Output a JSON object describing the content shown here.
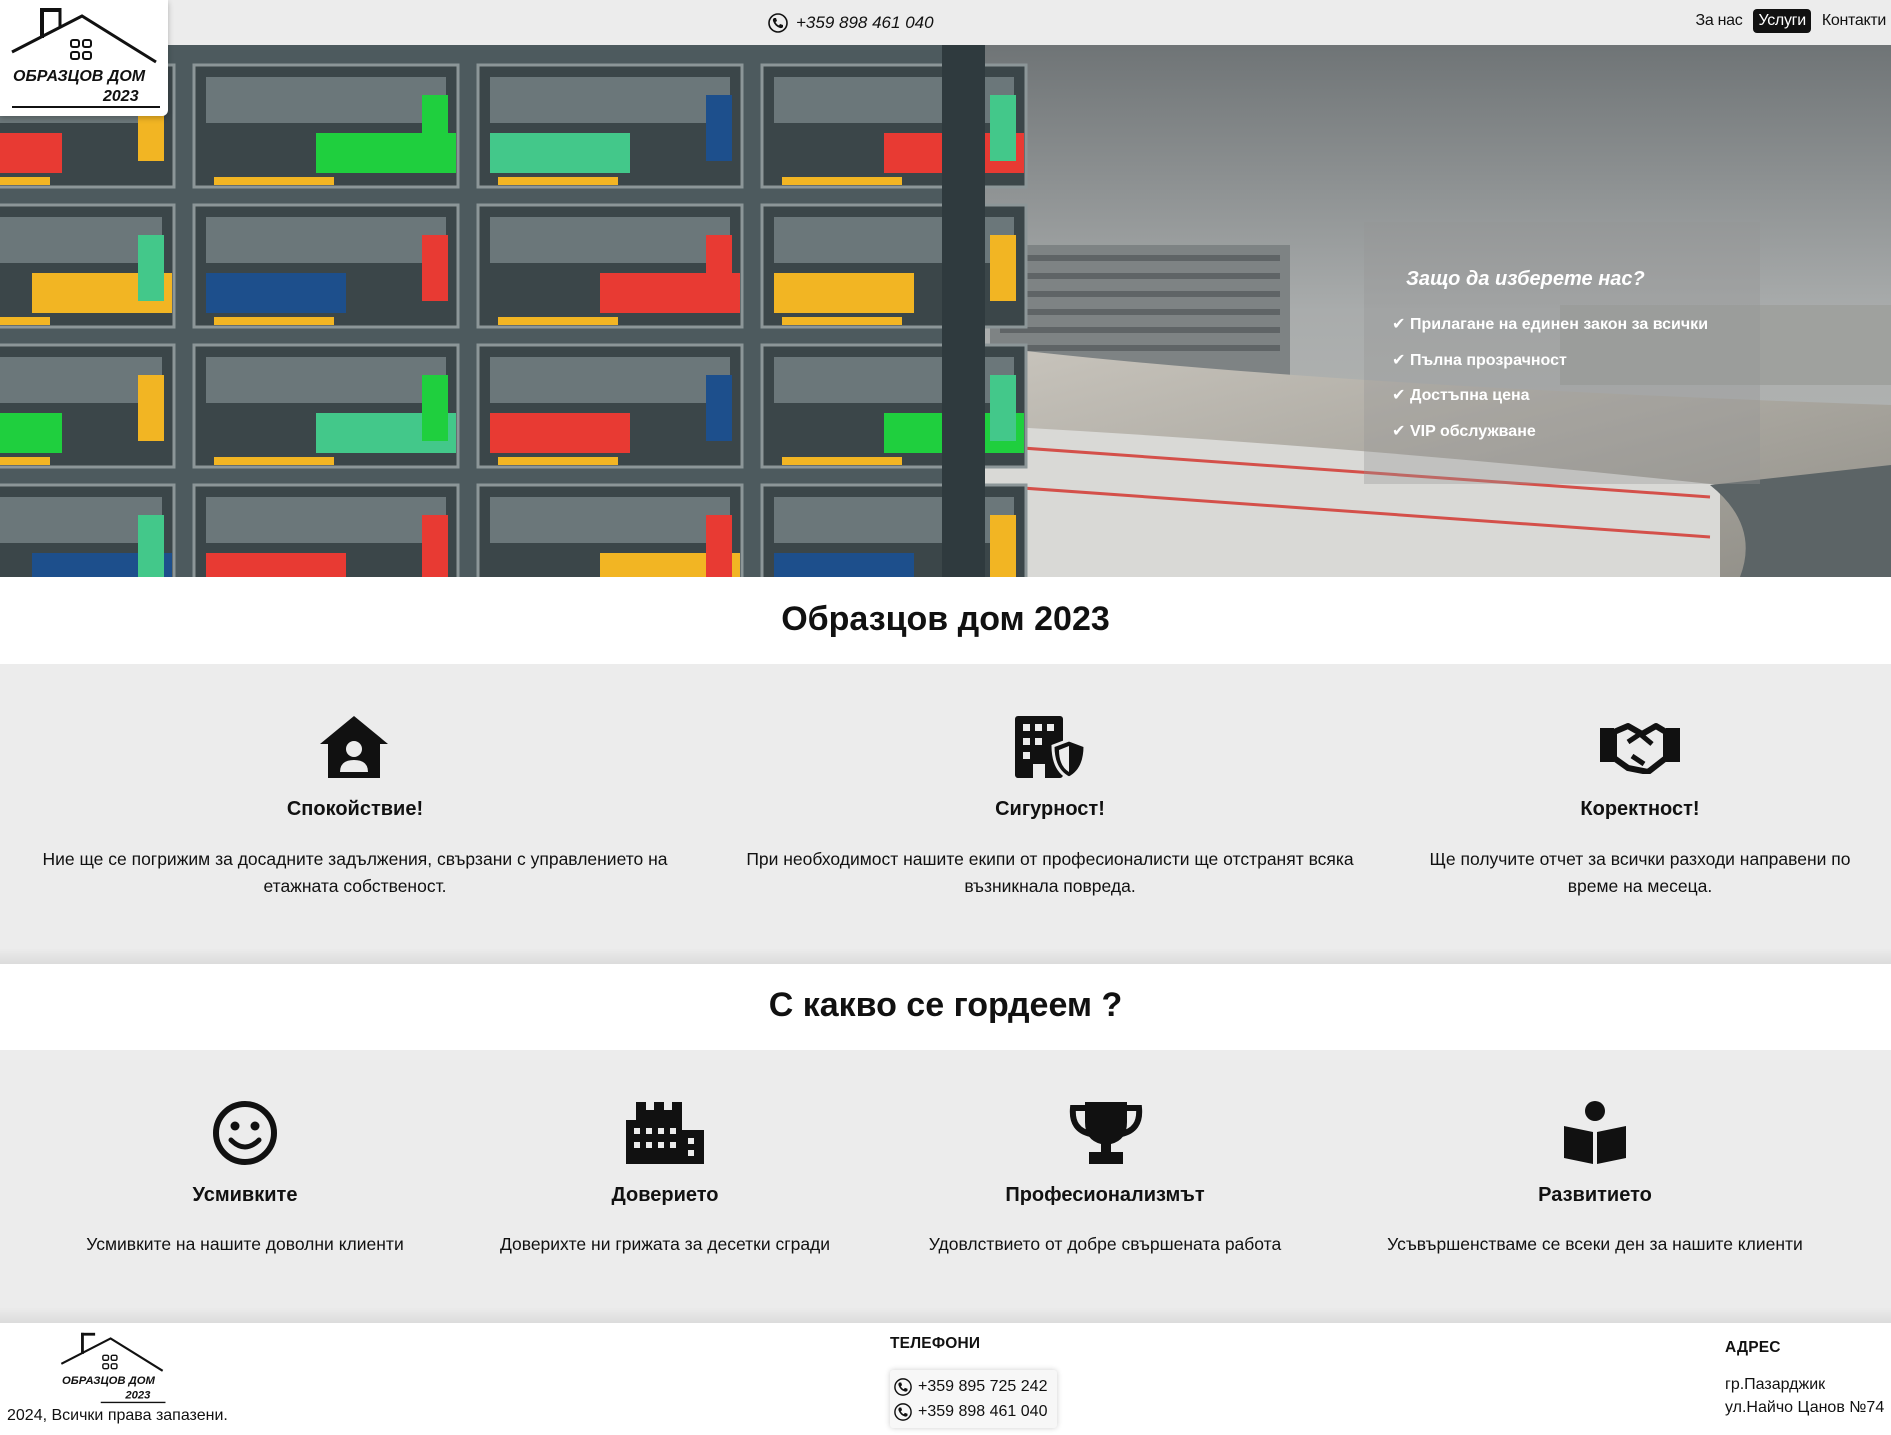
{
  "header": {
    "logo_text_1": "ОБРАЗЦОВ ДОМ",
    "logo_text_2": "2023",
    "phone": "+359 898 461 040",
    "nav": [
      {
        "label": "За нас",
        "active": false
      },
      {
        "label": "Услуги",
        "active": true
      },
      {
        "label": "Контакти",
        "active": false
      }
    ]
  },
  "hero": {
    "why_title": "Защо да изберете нас?",
    "why_items": [
      "Прилагане на единен закон за всички",
      "Пълна прозрачност",
      "Достъпна цена",
      "VIP обслужване"
    ]
  },
  "section1": {
    "title": "Образцов дом 2023",
    "cards": [
      {
        "icon": "house-user-icon",
        "title": "Спокойствие!",
        "text": "Ние ще се погрижим за досадните задължения, свързани с управлението на етажната собственост."
      },
      {
        "icon": "building-shield-icon",
        "title": "Сигурност!",
        "text": "При необходимост нашите екипи от професионалисти ще отстранят всяка възникнала повреда."
      },
      {
        "icon": "handshake-icon",
        "title": "Коректност!",
        "text": "Ще получите отчет за всички разходи направени по време на месеца."
      }
    ]
  },
  "section2": {
    "title": "С какво се гордеем ?",
    "cards": [
      {
        "icon": "smile-icon",
        "title": "Усмивките",
        "text": "Усмивките на нашите доволни клиенти"
      },
      {
        "icon": "city-icon",
        "title": "Доверието",
        "text": "Доверихте ни грижата за десетки сгради"
      },
      {
        "icon": "trophy-icon",
        "title": "Професионализмът",
        "text": "Удовлствието от добре свършената работа"
      },
      {
        "icon": "book-reader-icon",
        "title": "Развитието",
        "text": "Усъвършенстваме се всеки ден за нашите клиенти"
      }
    ]
  },
  "footer": {
    "copyright": "2024, Всички права запазени.",
    "phones_heading": "ТЕЛЕФОНИ",
    "phones": [
      "+359 895 725 242",
      "+359 898 461 040"
    ],
    "address_heading": "АДРЕС",
    "address_lines": [
      "гр.Пазарджик",
      "ул.Найчо Цанов №74"
    ]
  }
}
